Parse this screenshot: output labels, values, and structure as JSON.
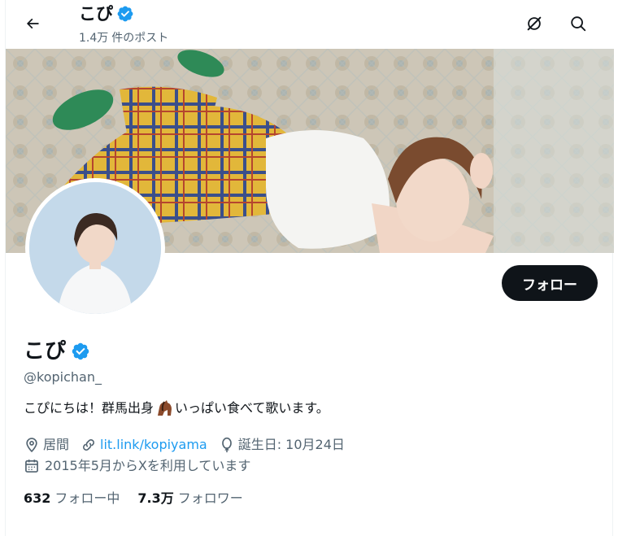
{
  "header": {
    "back_icon": "arrow-left-icon",
    "name": "こぴ",
    "verified_icon": "verified-badge-icon",
    "post_count_value": "1.4万",
    "post_count_label": "件のポスト",
    "grok_icon": "grok-icon",
    "search_icon": "search-icon"
  },
  "profile": {
    "name": "こぴ",
    "handle": "@kopichan_",
    "follow_label": "フォロー",
    "bio_before": "こぴにちは！群馬出身",
    "bio_emoji": "horse-emoji",
    "bio_after": "いっぱい食べて歌います。",
    "location": "居間",
    "link": "lit.link/kopiyama",
    "birthday": "誕生日: 10月24日",
    "joined": "2015年5月からXを利用しています",
    "following_count": "632",
    "following_label": "フォロー中",
    "followers_count": "7.3万",
    "followers_label": "フォロワー"
  },
  "colors": {
    "verified": "#1d9bf0",
    "link": "#1d9bf0",
    "follow_button_bg": "#0f1419",
    "secondary_text": "#536471"
  }
}
